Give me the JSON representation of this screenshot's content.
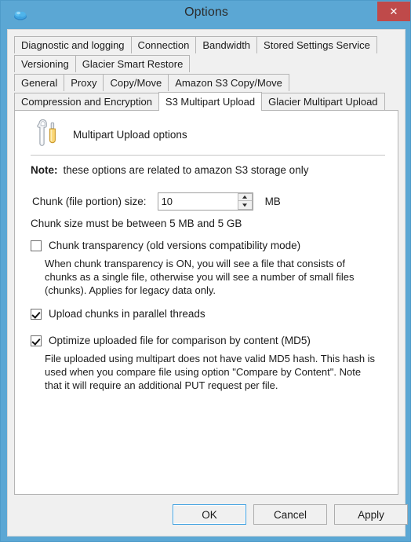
{
  "window": {
    "title": "Options",
    "app_icon": "cloud-icon",
    "close_label": "✕",
    "accent_color": "#5ba7d4",
    "close_button_color": "#bf4a4a"
  },
  "tabs": {
    "rows": [
      [
        {
          "label": "Diagnostic and logging",
          "selected": false
        },
        {
          "label": "Connection",
          "selected": false
        },
        {
          "label": "Bandwidth",
          "selected": false
        },
        {
          "label": "Stored Settings Service",
          "selected": false
        }
      ],
      [
        {
          "label": "Versioning",
          "selected": false
        },
        {
          "label": "Glacier Smart Restore",
          "selected": false
        }
      ],
      [
        {
          "label": "General",
          "selected": false
        },
        {
          "label": "Proxy",
          "selected": false
        },
        {
          "label": "Copy/Move",
          "selected": false
        },
        {
          "label": "Amazon S3 Copy/Move",
          "selected": false
        }
      ],
      [
        {
          "label": "Compression and Encryption",
          "selected": false
        },
        {
          "label": "S3 Multipart Upload",
          "selected": true
        },
        {
          "label": "Glacier Multipart Upload",
          "selected": false
        }
      ]
    ]
  },
  "panel": {
    "header_icon": "wrench-and-screwdriver-icon",
    "header_label": "Multipart Upload options",
    "note_label": "Note:",
    "note_text": "these options are related to amazon S3 storage only",
    "chunk_size_label": "Chunk (file portion) size:",
    "chunk_size_value": "10",
    "chunk_size_unit": "MB",
    "chunk_size_hint": "Chunk size must be between 5 MB and 5 GB",
    "chunk_transparency": {
      "label": "Chunk transparency (old versions compatibility mode)",
      "checked": false,
      "description": "When chunk transparency is ON, you will see a file that consists of chunks as a single file, otherwise you will see a number of small files (chunks). Applies for legacy data only."
    },
    "parallel_threads": {
      "label": "Upload chunks in parallel threads",
      "checked": true
    },
    "md5": {
      "label": "Optimize uploaded file for comparison by content (MD5)",
      "checked": true,
      "description": "File uploaded using multipart does not have valid MD5 hash. This hash is used when you compare file using option \"Compare by Content\". Note that it will require an additional PUT request per file."
    }
  },
  "buttons": {
    "ok": "OK",
    "cancel": "Cancel",
    "apply": "Apply"
  }
}
